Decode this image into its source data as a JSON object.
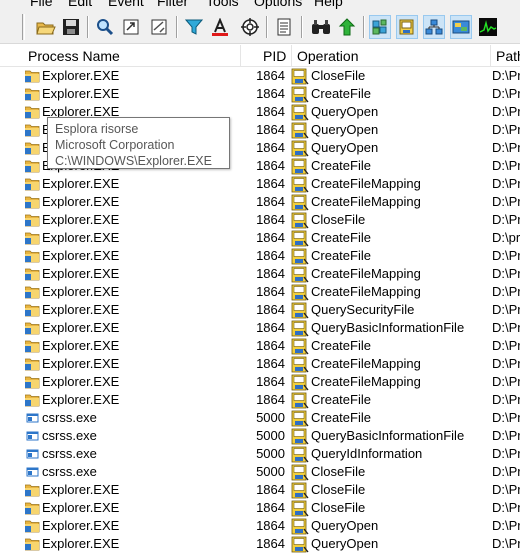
{
  "menu": {
    "items": [
      "File",
      "Edit",
      "Event",
      "Filter",
      "Tools",
      "Options",
      "Help"
    ]
  },
  "toolbar": {
    "buttons": [
      "open-icon",
      "save-icon",
      "magnify-icon",
      "autoscroll-icon",
      "filter-icon",
      "highlight-icon",
      "target-icon",
      "properties-icon",
      "find-icon",
      "jump-icon",
      "registry-activity-icon",
      "file-activity-icon",
      "network-activity-icon",
      "process-activity-icon",
      "profiling-activity-icon"
    ]
  },
  "columns": {
    "process": "Process Name",
    "pid": "PID",
    "operation": "Operation",
    "path": "Path"
  },
  "tooltip": {
    "line1": "Esplora risorse",
    "line2": "Microsoft Corporation",
    "line3": "C:\\WINDOWS\\Explorer.EXE"
  },
  "rows": [
    {
      "process": "Explorer.EXE",
      "pid": "1864",
      "operation": "CloseFile",
      "path": "D:\\Pr"
    },
    {
      "process": "Explorer.EXE",
      "pid": "1864",
      "operation": "CreateFile",
      "path": "D:\\Pr"
    },
    {
      "process": "Explorer.EXE",
      "pid": "1864",
      "operation": "QueryOpen",
      "path": "D:\\Pr"
    },
    {
      "process": "Explorer.EXE",
      "pid": "1864",
      "operation": "QueryOpen",
      "path": "D:\\Pr"
    },
    {
      "process": "Explorer.EXE",
      "pid": "1864",
      "operation": "QueryOpen",
      "path": "D:\\Pr"
    },
    {
      "process": "Explorer.EXE",
      "pid": "1864",
      "operation": "CreateFile",
      "path": "D:\\Pr"
    },
    {
      "process": "Explorer.EXE",
      "pid": "1864",
      "operation": "CreateFileMapping",
      "path": "D:\\Pr"
    },
    {
      "process": "Explorer.EXE",
      "pid": "1864",
      "operation": "CreateFileMapping",
      "path": "D:\\Pr"
    },
    {
      "process": "Explorer.EXE",
      "pid": "1864",
      "operation": "CloseFile",
      "path": "D:\\Pr"
    },
    {
      "process": "Explorer.EXE",
      "pid": "1864",
      "operation": "CreateFile",
      "path": "D:\\pr"
    },
    {
      "process": "Explorer.EXE",
      "pid": "1864",
      "operation": "CreateFile",
      "path": "D:\\Pr"
    },
    {
      "process": "Explorer.EXE",
      "pid": "1864",
      "operation": "CreateFileMapping",
      "path": "D:\\Pr"
    },
    {
      "process": "Explorer.EXE",
      "pid": "1864",
      "operation": "CreateFileMapping",
      "path": "D:\\Pr"
    },
    {
      "process": "Explorer.EXE",
      "pid": "1864",
      "operation": "QuerySecurityFile",
      "path": "D:\\Pr"
    },
    {
      "process": "Explorer.EXE",
      "pid": "1864",
      "operation": "QueryBasicInformationFile",
      "path": "D:\\Pr"
    },
    {
      "process": "Explorer.EXE",
      "pid": "1864",
      "operation": "CreateFile",
      "path": "D:\\Pr"
    },
    {
      "process": "Explorer.EXE",
      "pid": "1864",
      "operation": "CreateFileMapping",
      "path": "D:\\Pr"
    },
    {
      "process": "Explorer.EXE",
      "pid": "1864",
      "operation": "CreateFileMapping",
      "path": "D:\\Pr"
    },
    {
      "process": "Explorer.EXE",
      "pid": "1864",
      "operation": "CreateFile",
      "path": "D:\\Pr"
    },
    {
      "process": "csrss.exe",
      "pid": "5000",
      "operation": "CreateFile",
      "path": "D:\\Pr"
    },
    {
      "process": "csrss.exe",
      "pid": "5000",
      "operation": "QueryBasicInformationFile",
      "path": "D:\\Pr"
    },
    {
      "process": "csrss.exe",
      "pid": "5000",
      "operation": "QueryIdInformation",
      "path": "D:\\Pr"
    },
    {
      "process": "csrss.exe",
      "pid": "5000",
      "operation": "CloseFile",
      "path": "D:\\Pr"
    },
    {
      "process": "Explorer.EXE",
      "pid": "1864",
      "operation": "CloseFile",
      "path": "D:\\Pr"
    },
    {
      "process": "Explorer.EXE",
      "pid": "1864",
      "operation": "CloseFile",
      "path": "D:\\Pr"
    },
    {
      "process": "Explorer.EXE",
      "pid": "1864",
      "operation": "QueryOpen",
      "path": "D:\\Pr"
    },
    {
      "process": "Explorer.EXE",
      "pid": "1864",
      "operation": "QueryOpen",
      "path": "D:\\Pr"
    }
  ]
}
